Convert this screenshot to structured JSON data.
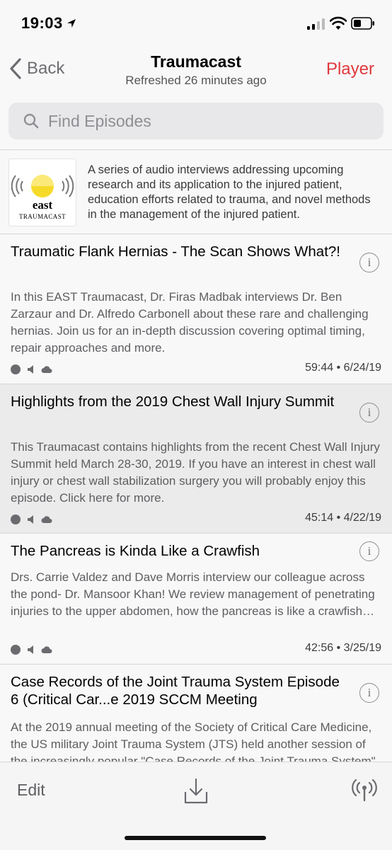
{
  "status": {
    "time": "19:03"
  },
  "nav": {
    "back_label": "Back",
    "title": "Traumacast",
    "subtitle": "Refreshed 26 minutes ago",
    "player_label": "Player"
  },
  "search": {
    "placeholder": "Find Episodes"
  },
  "podcast": {
    "art_brand": "east",
    "art_sub": "TRAUMACAST",
    "description": "A series of audio interviews addressing upcoming research and its application to the injured patient, education efforts related to trauma, and novel methods in the management of the injured patient."
  },
  "episodes": [
    {
      "title": "Traumatic Flank Hernias - The Scan Shows What?!",
      "description": "In this EAST Traumacast, Dr. Firas Madbak interviews Dr. Ben Zarzaur and Dr. Alfredo Carbonell about these rare and challenging hernias. Join us for an in-depth discussion covering optimal timing, repair approaches and more.",
      "meta": "59:44 • 6/24/19"
    },
    {
      "title": "Highlights from the 2019 Chest Wall Injury Summit",
      "description": "This Traumacast contains highlights from the recent Chest Wall Injury Summit held March 28-30, 2019.  If you have an interest in chest wall injury or chest wall stabilization surgery you will probably enjoy this episode.    Click here for more.",
      "meta": "45:14 • 4/22/19"
    },
    {
      "title": "The Pancreas is Kinda Like a Crawfish",
      "description": "Drs. Carrie Valdez and Dave Morris interview our colleague across the pond- Dr. Mansoor Khan! We review management of penetrating injuries to the upper abdomen, how the pancreas is like a crawfish and finish up with more.",
      "meta": "42:56 • 3/25/19"
    },
    {
      "title": "Case Records of the Joint Trauma System Episode 6 (Critical Car...e 2019 SCCM Meeting",
      "description": "At the 2019 annual meeting of the Society of Critical Care Medicine, the US military Joint Trauma System (JTS) held another session of the increasingly popular \"Case Records of the Joint Trauma System\"."
    }
  ],
  "toolbar": {
    "edit_label": "Edit"
  },
  "colors": {
    "accent": "#e0393e",
    "highlight_row": "#ebebeb",
    "background": "#f8f8f8"
  }
}
